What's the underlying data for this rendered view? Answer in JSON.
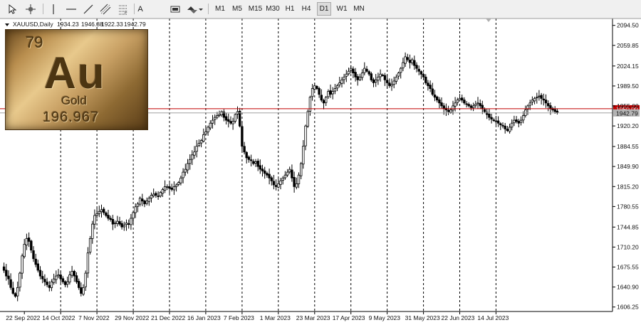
{
  "toolbar": {
    "tools": [
      {
        "name": "cursor-tool",
        "icon": "cursor-icon"
      },
      {
        "name": "crosshair-tool",
        "icon": "crosshair-icon"
      },
      {
        "name": "vertical-line-tool",
        "icon": "vertical-line-icon"
      },
      {
        "name": "horizontal-line-tool",
        "icon": "horizontal-line-icon"
      },
      {
        "name": "trendline-tool",
        "icon": "trendline-icon"
      },
      {
        "name": "channel-tool",
        "icon": "channel-icon"
      },
      {
        "name": "fibonacci-tool",
        "icon": "fibonacci-icon"
      },
      {
        "name": "text-tool",
        "label": "A"
      },
      {
        "name": "label-tool",
        "icon": "label-icon"
      },
      {
        "name": "arrows-tool",
        "icon": "arrows-icon"
      }
    ],
    "timeframes": [
      "M1",
      "M5",
      "M15",
      "M30",
      "H1",
      "H4",
      "D1",
      "W1",
      "MN"
    ],
    "active_timeframe": "D1"
  },
  "symbol_info": {
    "symbol": "XAUUSD,Daily",
    "open": "1934.23",
    "high": "1946.88",
    "low": "1922.33",
    "close": "1942.79"
  },
  "gold_tile": {
    "number": "79",
    "symbol": "Au",
    "name": "Gold",
    "mass": "196.967"
  },
  "colors": {
    "bull": "#ffffff",
    "bear": "#000000",
    "grid": "#000000",
    "level_line": "#c00000",
    "bid_line": "#a0a0a0"
  },
  "chart_data": {
    "type": "candlestick",
    "symbol": "XAUUSD",
    "timeframe": "Daily",
    "ylim": [
      1601.0,
      2104.0
    ],
    "y_ticks": [
      "2094.50",
      "2059.85",
      "2024.15",
      "1989.50",
      "1955.00",
      "1920.20",
      "1884.55",
      "1849.90",
      "1815.20",
      "1780.55",
      "1744.85",
      "1710.20",
      "1675.55",
      "1640.90",
      "1606.25"
    ],
    "x_tick_labels": [
      "22 Sep 2022",
      "14 Oct 2022",
      "7 Nov 2022",
      "29 Nov 2022",
      "21 Dec 2022",
      "16 Jan 2023",
      "7 Feb 2023",
      "1 Mar 2023",
      "23 Mar 2023",
      "17 Apr 2023",
      "9 May 2023",
      "31 May 2023",
      "22 Jun 2023",
      "14 Jul 2023"
    ],
    "grid": "vertical dotted",
    "levels": [
      {
        "value": 1950.0,
        "label": "1950.00"
      }
    ],
    "current_price": {
      "value": 1942.79,
      "label": "1942.79"
    },
    "closes": [
      1670,
      1660,
      1655,
      1640,
      1630,
      1625,
      1640,
      1665,
      1695,
      1715,
      1725,
      1720,
      1705,
      1690,
      1680,
      1670,
      1660,
      1655,
      1650,
      1645,
      1640,
      1650,
      1655,
      1660,
      1662,
      1655,
      1650,
      1645,
      1650,
      1662,
      1668,
      1660,
      1650,
      1640,
      1630,
      1640,
      1665,
      1700,
      1725,
      1750,
      1765,
      1768,
      1772,
      1775,
      1770,
      1765,
      1760,
      1758,
      1750,
      1752,
      1755,
      1750,
      1745,
      1748,
      1752,
      1750,
      1760,
      1770,
      1780,
      1785,
      1795,
      1790,
      1785,
      1790,
      1795,
      1800,
      1802,
      1800,
      1798,
      1805,
      1810,
      1815,
      1815,
      1812,
      1810,
      1815,
      1818,
      1822,
      1830,
      1840,
      1845,
      1855,
      1862,
      1870,
      1875,
      1885,
      1890,
      1895,
      1905,
      1910,
      1918,
      1925,
      1930,
      1935,
      1938,
      1940,
      1945,
      1935,
      1930,
      1928,
      1925,
      1928,
      1940,
      1945,
      1920,
      1885,
      1875,
      1865,
      1862,
      1860,
      1855,
      1858,
      1850,
      1845,
      1842,
      1838,
      1835,
      1830,
      1825,
      1818,
      1815,
      1820,
      1825,
      1830,
      1835,
      1840,
      1845,
      1830,
      1815,
      1820,
      1835,
      1855,
      1885,
      1920,
      1945,
      1970,
      1985,
      1990,
      1985,
      1975,
      1965,
      1960,
      1970,
      1980,
      1975,
      1980,
      1985,
      1990,
      1995,
      2000,
      2005,
      2010,
      2015,
      2020,
      2012,
      2005,
      2000,
      2005,
      2012,
      2020,
      2015,
      2010,
      2000,
      1995,
      2000,
      2005,
      2010,
      2008,
      2000,
      1995,
      1990,
      1992,
      1998,
      2005,
      2012,
      2020,
      2030,
      2040,
      2035,
      2030,
      2035,
      2025,
      2020,
      2015,
      2010,
      2005,
      1995,
      1990,
      1985,
      1975,
      1970,
      1965,
      1960,
      1955,
      1950,
      1948,
      1945,
      1948,
      1955,
      1960,
      1965,
      1968,
      1965,
      1960,
      1958,
      1955,
      1952,
      1955,
      1958,
      1960,
      1955,
      1950,
      1945,
      1940,
      1935,
      1932,
      1930,
      1928,
      1925,
      1922,
      1920,
      1915,
      1912,
      1918,
      1925,
      1930,
      1928,
      1925,
      1930,
      1938,
      1948,
      1955,
      1960,
      1965,
      1968,
      1970,
      1972,
      1968,
      1965,
      1960,
      1955,
      1950,
      1948,
      1945,
      1943
    ]
  }
}
